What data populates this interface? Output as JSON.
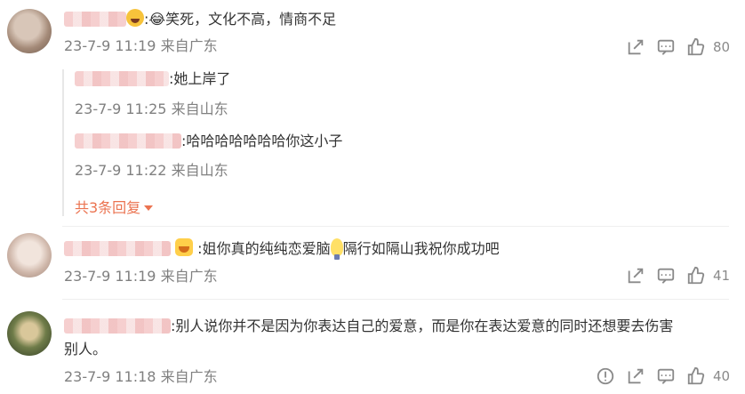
{
  "comments": [
    {
      "text_after": ":😂笑死，文化不高，情商不足",
      "date": "23-7-9 11:19",
      "location": "来自广东",
      "likes": "80",
      "replies": [
        {
          "text_after": ":她上岸了",
          "date": "23-7-9 11:25",
          "location": "来自山东"
        },
        {
          "text_after": ":哈哈哈哈哈哈哈你这小子",
          "date": "23-7-9 11:22",
          "location": "来自山东"
        }
      ],
      "more_replies": "共3条回复"
    },
    {
      "text_a": " :姐你真的纯纯恋爱脑",
      "text_b": "隔行如隔山我祝你成功吧",
      "date": "23-7-9 11:19",
      "location": "来自广东",
      "likes": "41"
    },
    {
      "text_line1": ":别人说你并不是因为你表达自己的爱意，而是你在表达爱意的同时还想要去伤害",
      "text_line2": "别人。",
      "date": "23-7-9 11:18",
      "location": "来自广东",
      "likes": "40"
    }
  ],
  "icons": {
    "share": "share-icon",
    "comment": "comment-icon",
    "like": "thumbs-up-icon",
    "report": "report-icon"
  },
  "colors": {
    "accent": "#eb7350",
    "meta": "#808080",
    "text": "#333333"
  }
}
